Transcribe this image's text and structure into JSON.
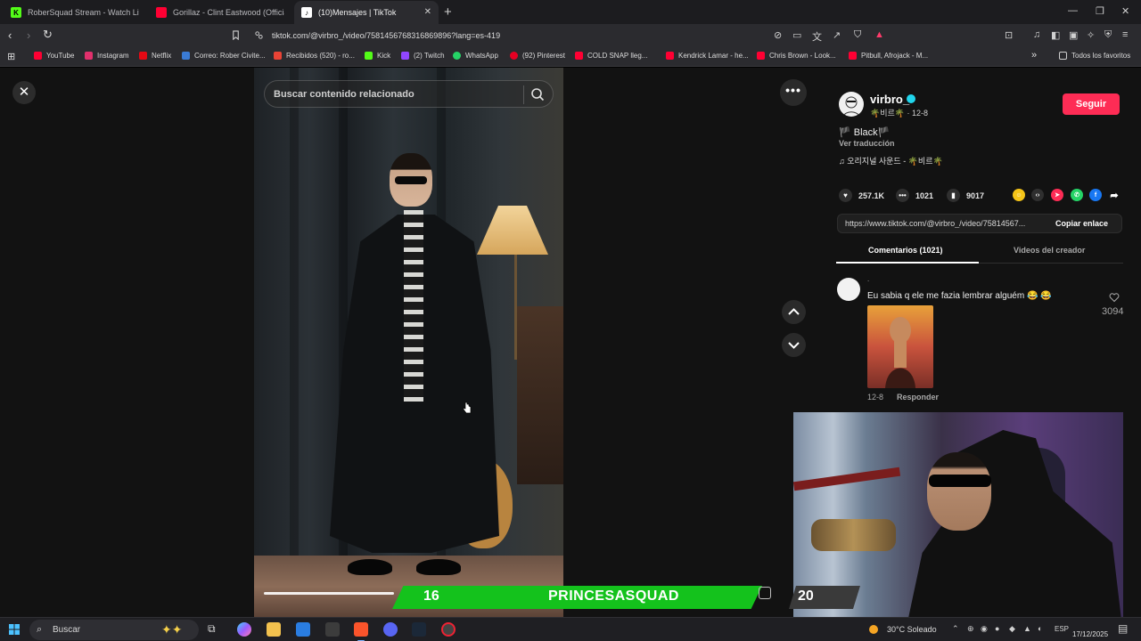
{
  "browser": {
    "tabs": [
      {
        "title": "RoberSquad Stream - Watch Live",
        "favicon": "kick-icon",
        "color": "#53fc18",
        "active": false
      },
      {
        "title": "Gorillaz - Clint Eastwood (Official Video)",
        "favicon": "youtube-icon",
        "color": "#ff0033",
        "active": false
      },
      {
        "title": "(10)Mensajes | TikTok",
        "favicon": "tiktok-icon",
        "color": "#ffffff",
        "active": true
      }
    ],
    "url": "tiktok.com/@virbro_/video/7581456768316869896?lang=es-419",
    "bookmarks": [
      {
        "label": "YouTube",
        "color": "#ff0033"
      },
      {
        "label": "Instagram",
        "color": "#e1306c"
      },
      {
        "label": "Netflix",
        "color": "#e50914"
      },
      {
        "label": "Correo: Rober Civite...",
        "color": "#3a7bd5"
      },
      {
        "label": "Recibidos (520) - ro...",
        "color": "#ea4335"
      },
      {
        "label": "Kick",
        "color": "#53fc18"
      },
      {
        "label": "(2) Twitch",
        "color": "#9146ff"
      },
      {
        "label": "WhatsApp",
        "color": "#25d366"
      },
      {
        "label": "(92) Pinterest",
        "color": "#e60023"
      },
      {
        "label": "COLD SNAP lleg...",
        "color": "#4da3ff"
      },
      {
        "label": "Kendrick Lamar - he...",
        "color": "#ff0033"
      },
      {
        "label": "Chris Brown - Look...",
        "color": "#ff0033"
      },
      {
        "label": "Pitbull, Afrojack - M...",
        "color": "#ff0033"
      }
    ],
    "all_bookmarks": "Todos los favoritos"
  },
  "video": {
    "search_placeholder": "Buscar contenido relacionado",
    "progress": 0.45
  },
  "panel": {
    "username": "virbro_",
    "subtitle": "🌴비르🌴 · 12-8",
    "follow_label": "Seguir",
    "description": "🏴 Black🏴",
    "translate": "Ver traducción",
    "music": "♫  오리지널 사운드 - 🌴비르🌴",
    "likes": "257.1K",
    "comments_count": "1021",
    "saves": "9017",
    "link": "https://www.tiktok.com/@virbro_/video/75814567...",
    "copy_label": "Copiar enlace",
    "tab_comments": "Comentarios (1021)",
    "tab_creator": "Videos del creador"
  },
  "comment": {
    "user": ".",
    "text": "Eu sabia q ele me fazia lembrar alguém 😂 😂",
    "date": "12-8",
    "reply": "Responder",
    "likes": "3094"
  },
  "overlay": {
    "left_number": "16",
    "squad_name": "PRINCESASQUAD",
    "right_number": "20"
  },
  "taskbar": {
    "search_placeholder": "Buscar",
    "weather": "30°C  Soleado",
    "lang": "ESP",
    "date": "17/12/2025"
  }
}
